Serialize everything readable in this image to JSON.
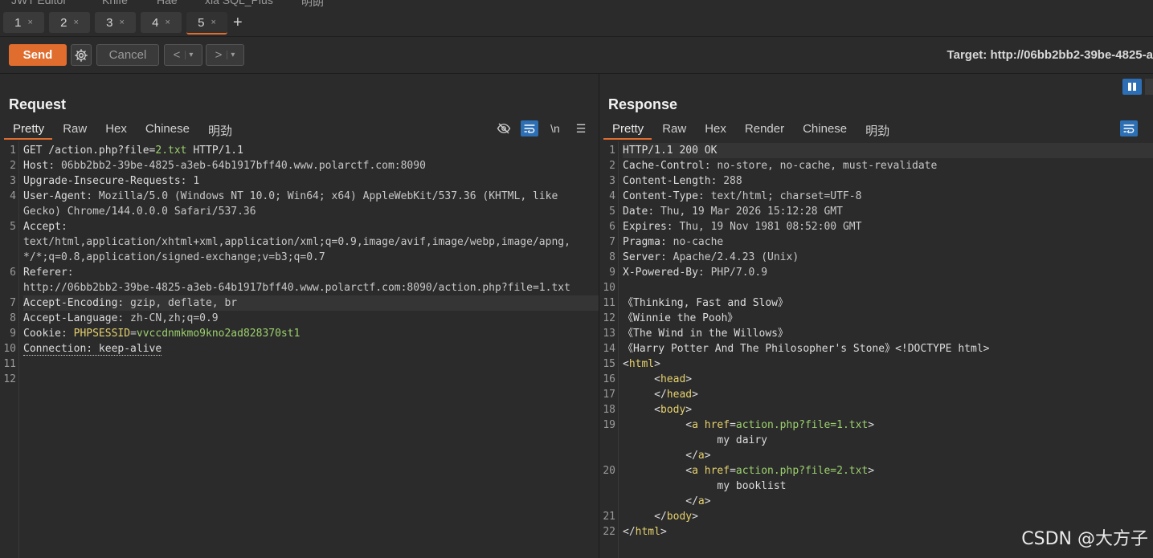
{
  "top_menu": [
    "JWT Editor",
    "Knife",
    "Hae",
    "xia SQL_Plus",
    "明朗"
  ],
  "tabs": [
    {
      "label": "1",
      "close": "×"
    },
    {
      "label": "2",
      "close": "×"
    },
    {
      "label": "3",
      "close": "×"
    },
    {
      "label": "4",
      "close": "×"
    },
    {
      "label": "5",
      "close": "×"
    }
  ],
  "active_tab": "5",
  "add_tab": "+",
  "toolbar": {
    "send_label": "Send",
    "cancel_label": "Cancel",
    "back_label": "<",
    "forward_label": ">",
    "dropdown": "▾",
    "target": "Target: http://06bb2bb2-39be-4825-a"
  },
  "request": {
    "title": "Request",
    "tabs": [
      "Pretty",
      "Raw",
      "Hex",
      "Chinese",
      "明劲"
    ],
    "newline_tool": "\\n",
    "lines": [
      {
        "n": "1",
        "segments": [
          [
            "k",
            "GET /action.php?file="
          ],
          [
            "g",
            "2.txt"
          ],
          [
            "k",
            " HTTP/1.1"
          ]
        ]
      },
      {
        "n": "2",
        "segments": [
          [
            "k",
            "Host"
          ],
          [
            "v",
            ": 06bb2bb2-39be-4825-a3eb-64b1917bff40.www.polarctf.com:8090"
          ]
        ]
      },
      {
        "n": "3",
        "segments": [
          [
            "k",
            "Upgrade-Insecure-Requests"
          ],
          [
            "v",
            ": 1"
          ]
        ]
      },
      {
        "n": "4",
        "segments": [
          [
            "k",
            "User-Agent"
          ],
          [
            "v",
            ": Mozilla/5.0 (Windows NT 10.0; Win64; x64) AppleWebKit/537.36 (KHTML, like"
          ]
        ]
      },
      {
        "n": "",
        "segments": [
          [
            "v",
            "Gecko) Chrome/144.0.0.0 Safari/537.36"
          ]
        ]
      },
      {
        "n": "5",
        "segments": [
          [
            "k",
            "Accept"
          ],
          [
            "v",
            ":"
          ]
        ]
      },
      {
        "n": "",
        "segments": [
          [
            "v",
            "text/html,application/xhtml+xml,application/xml;q=0.9,image/avif,image/webp,image/apng,"
          ]
        ]
      },
      {
        "n": "",
        "segments": [
          [
            "v",
            "*/*;q=0.8,application/signed-exchange;v=b3;q=0.7"
          ]
        ]
      },
      {
        "n": "6",
        "segments": [
          [
            "k",
            "Referer"
          ],
          [
            "v",
            ":"
          ]
        ]
      },
      {
        "n": "",
        "segments": [
          [
            "v",
            "http://06bb2bb2-39be-4825-a3eb-64b1917bff40.www.polarctf.com:8090/action.php?file=1.txt"
          ]
        ]
      },
      {
        "n": "7",
        "hl": true,
        "segments": [
          [
            "k",
            "Accept-Encoding"
          ],
          [
            "v",
            ": gzip, deflate, br"
          ]
        ]
      },
      {
        "n": "8",
        "segments": [
          [
            "k",
            "Accept-Language"
          ],
          [
            "v",
            ": zh-CN,zh;q=0.9"
          ]
        ]
      },
      {
        "n": "9",
        "segments": [
          [
            "k",
            "Cookie"
          ],
          [
            "v",
            ": "
          ],
          [
            "t",
            "PHPSESSID"
          ],
          [
            "v",
            "="
          ],
          [
            "g",
            "vvccdnmkmo9kno2ad828370st1"
          ]
        ]
      },
      {
        "n": "10",
        "segments": [
          [
            "u",
            "Connection: keep-alive"
          ]
        ]
      },
      {
        "n": "11",
        "segments": []
      },
      {
        "n": "12",
        "segments": []
      }
    ]
  },
  "response": {
    "title": "Response",
    "tabs": [
      "Pretty",
      "Raw",
      "Hex",
      "Render",
      "Chinese",
      "明劲"
    ],
    "lines": [
      {
        "n": "1",
        "hl": true,
        "segments": [
          [
            "k",
            "HTTP/1.1 200 OK"
          ]
        ]
      },
      {
        "n": "2",
        "segments": [
          [
            "k",
            "Cache-Control"
          ],
          [
            "v",
            ": no-store, no-cache, must-revalidate"
          ]
        ]
      },
      {
        "n": "3",
        "segments": [
          [
            "k",
            "Content-Length"
          ],
          [
            "v",
            ": 288"
          ]
        ]
      },
      {
        "n": "4",
        "segments": [
          [
            "k",
            "Content-Type"
          ],
          [
            "v",
            ": text/html; charset=UTF-8"
          ]
        ]
      },
      {
        "n": "5",
        "segments": [
          [
            "k",
            "Date"
          ],
          [
            "v",
            ": Thu, 19 Mar 2026 15:12:28 GMT"
          ]
        ]
      },
      {
        "n": "6",
        "segments": [
          [
            "k",
            "Expires"
          ],
          [
            "v",
            ": Thu, 19 Nov 1981 08:52:00 GMT"
          ]
        ]
      },
      {
        "n": "7",
        "segments": [
          [
            "k",
            "Pragma"
          ],
          [
            "v",
            ": no-cache"
          ]
        ]
      },
      {
        "n": "8",
        "segments": [
          [
            "k",
            "Server"
          ],
          [
            "v",
            ": Apache/2.4.23 (Unix)"
          ]
        ]
      },
      {
        "n": "9",
        "segments": [
          [
            "k",
            "X-Powered-By"
          ],
          [
            "v",
            ": PHP/7.0.9"
          ]
        ]
      },
      {
        "n": "10",
        "segments": []
      },
      {
        "n": "11",
        "segments": [
          [
            "k",
            "《Thinking, Fast and Slow》"
          ]
        ]
      },
      {
        "n": "12",
        "segments": [
          [
            "k",
            "《Winnie the Pooh》"
          ]
        ]
      },
      {
        "n": "13",
        "segments": [
          [
            "k",
            "《The Wind in the Willows》"
          ]
        ]
      },
      {
        "n": "14",
        "segments": [
          [
            "k",
            "《Harry Potter And The Philosopher's Stone》<!DOCTYPE html>"
          ]
        ]
      },
      {
        "n": "15",
        "segments": [
          [
            "k",
            "<"
          ],
          [
            "t",
            "html"
          ],
          [
            "k",
            ">"
          ]
        ]
      },
      {
        "n": "16",
        "segments": [
          [
            "k",
            "     <"
          ],
          [
            "t",
            "head"
          ],
          [
            "k",
            ">"
          ]
        ]
      },
      {
        "n": "17",
        "segments": [
          [
            "k",
            "     </"
          ],
          [
            "t",
            "head"
          ],
          [
            "k",
            ">"
          ]
        ]
      },
      {
        "n": "18",
        "segments": [
          [
            "k",
            "     <"
          ],
          [
            "t",
            "body"
          ],
          [
            "k",
            ">"
          ]
        ]
      },
      {
        "n": "19",
        "segments": [
          [
            "k",
            "          <"
          ],
          [
            "t",
            "a href"
          ],
          [
            "k",
            "="
          ],
          [
            "g",
            "action.php?file=1.txt"
          ],
          [
            "k",
            ">"
          ]
        ]
      },
      {
        "n": "",
        "segments": [
          [
            "k",
            "               my dairy"
          ]
        ]
      },
      {
        "n": "",
        "segments": [
          [
            "k",
            "          </"
          ],
          [
            "t",
            "a"
          ],
          [
            "k",
            ">"
          ]
        ]
      },
      {
        "n": "20",
        "segments": [
          [
            "k",
            "          <"
          ],
          [
            "t",
            "a href"
          ],
          [
            "k",
            "="
          ],
          [
            "g",
            "action.php?file=2.txt"
          ],
          [
            "k",
            ">"
          ]
        ]
      },
      {
        "n": "",
        "segments": [
          [
            "k",
            "               my booklist"
          ]
        ]
      },
      {
        "n": "",
        "segments": [
          [
            "k",
            "          </"
          ],
          [
            "t",
            "a"
          ],
          [
            "k",
            ">"
          ]
        ]
      },
      {
        "n": "21",
        "segments": [
          [
            "k",
            "     </"
          ],
          [
            "t",
            "body"
          ],
          [
            "k",
            ">"
          ]
        ]
      },
      {
        "n": "22",
        "segments": [
          [
            "k",
            "</"
          ],
          [
            "t",
            "html"
          ],
          [
            "k",
            ">"
          ]
        ]
      }
    ]
  },
  "watermark": "CSDN @大方子",
  "colors": {
    "accent": "#e06c2e",
    "toggle_blue": "#2d6fb5",
    "value_green": "#9bd06d",
    "tag_yellow": "#e6d16d"
  }
}
